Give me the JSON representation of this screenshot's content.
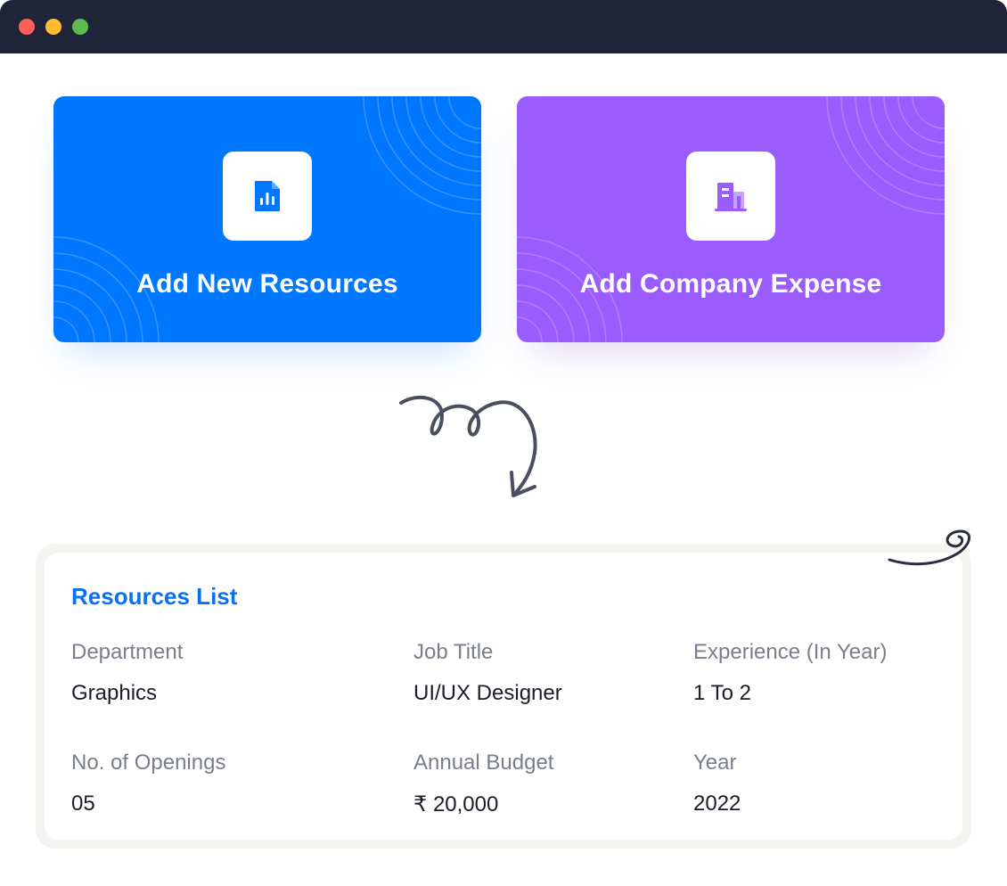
{
  "window": {
    "controls": [
      "close",
      "minimize",
      "maximize"
    ],
    "colors": {
      "close": "#fe5f57",
      "minimize": "#febc2e",
      "maximize": "#5dbb4f",
      "titlebar": "#1f2438"
    }
  },
  "cards": [
    {
      "label": "Add New Resources",
      "icon": "report-file-icon",
      "color": "#0077ff"
    },
    {
      "label": "Add Company Expense",
      "icon": "building-icon",
      "color": "#9a5cff"
    }
  ],
  "resources_list": {
    "title": "Resources List",
    "fields": [
      {
        "label": "Department",
        "value": "Graphics"
      },
      {
        "label": "Job Title",
        "value": "UI/UX Designer"
      },
      {
        "label": "Experience (In Year)",
        "value": "1 To 2"
      },
      {
        "label": "No. of Openings",
        "value": "05"
      },
      {
        "label": "Annual Budget",
        "value": "₹ 20,000"
      },
      {
        "label": "Year",
        "value": "2022"
      }
    ]
  }
}
